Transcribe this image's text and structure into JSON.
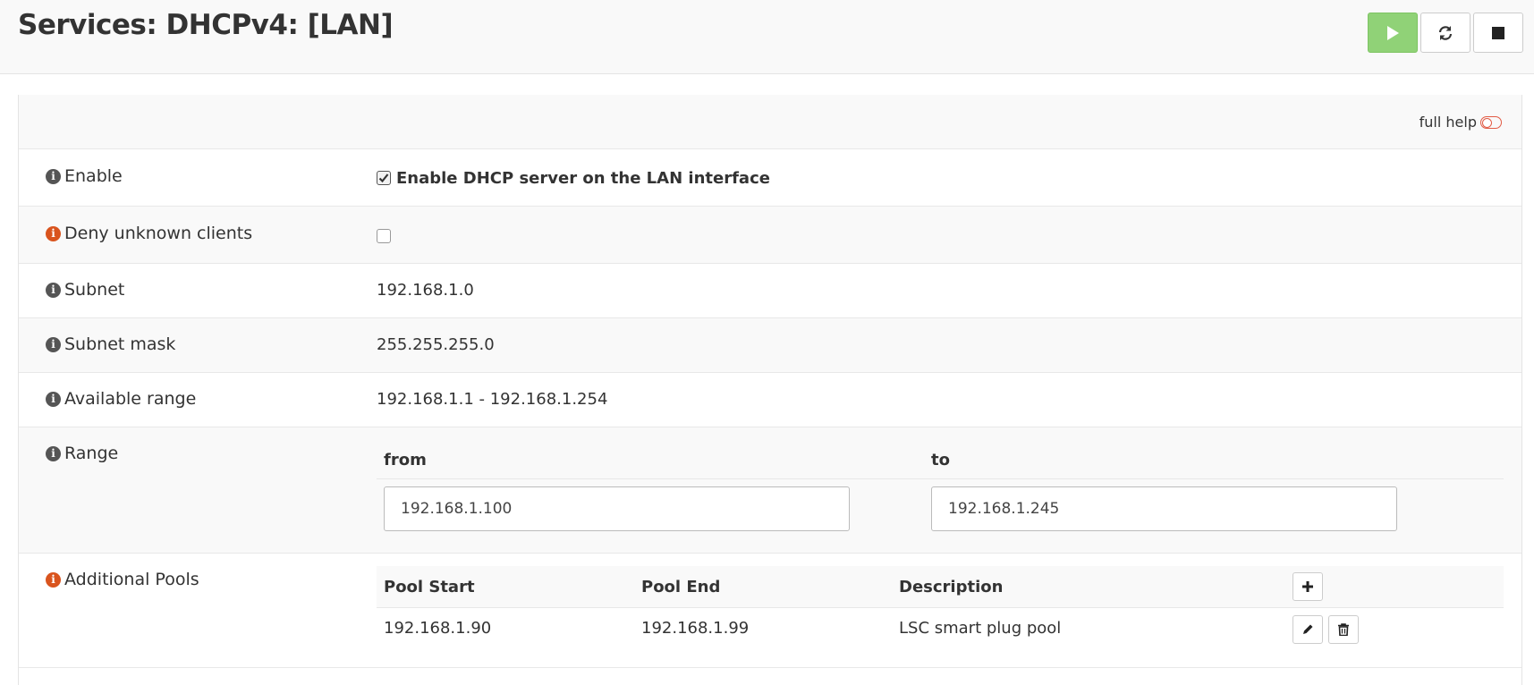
{
  "header": {
    "title": "Services: DHCPv4: [LAN]",
    "buttons": [
      {
        "name": "start",
        "icon": "play-icon",
        "color": "#90d277"
      },
      {
        "name": "restart",
        "icon": "refresh-icon"
      },
      {
        "name": "stop",
        "icon": "stop-icon"
      }
    ]
  },
  "help": {
    "label": "full help",
    "toggle_state": "off",
    "toggle_color": "#e25b45"
  },
  "rows": {
    "enable": {
      "label": "Enable",
      "checked": true,
      "checkbox_label": "Enable DHCP server on the LAN interface"
    },
    "deny_unknown": {
      "label": "Deny unknown clients",
      "checked": false
    },
    "subnet": {
      "label": "Subnet",
      "value": "192.168.1.0"
    },
    "subnet_mask": {
      "label": "Subnet mask",
      "value": "255.255.255.0"
    },
    "available_range": {
      "label": "Available range",
      "value": "192.168.1.1 - 192.168.1.254"
    },
    "range": {
      "label": "Range",
      "from_label": "from",
      "to_label": "to",
      "from_value": "192.168.1.100",
      "to_value": "192.168.1.245"
    },
    "additional_pools": {
      "label": "Additional Pools",
      "columns": [
        "Pool Start",
        "Pool End",
        "Description"
      ],
      "pools": [
        {
          "start": "192.168.1.90",
          "end": "192.168.1.99",
          "description": "LSC smart plug pool"
        }
      ]
    }
  },
  "colors": {
    "warn_icon": "#d9541e",
    "info_icon": "#555555"
  }
}
